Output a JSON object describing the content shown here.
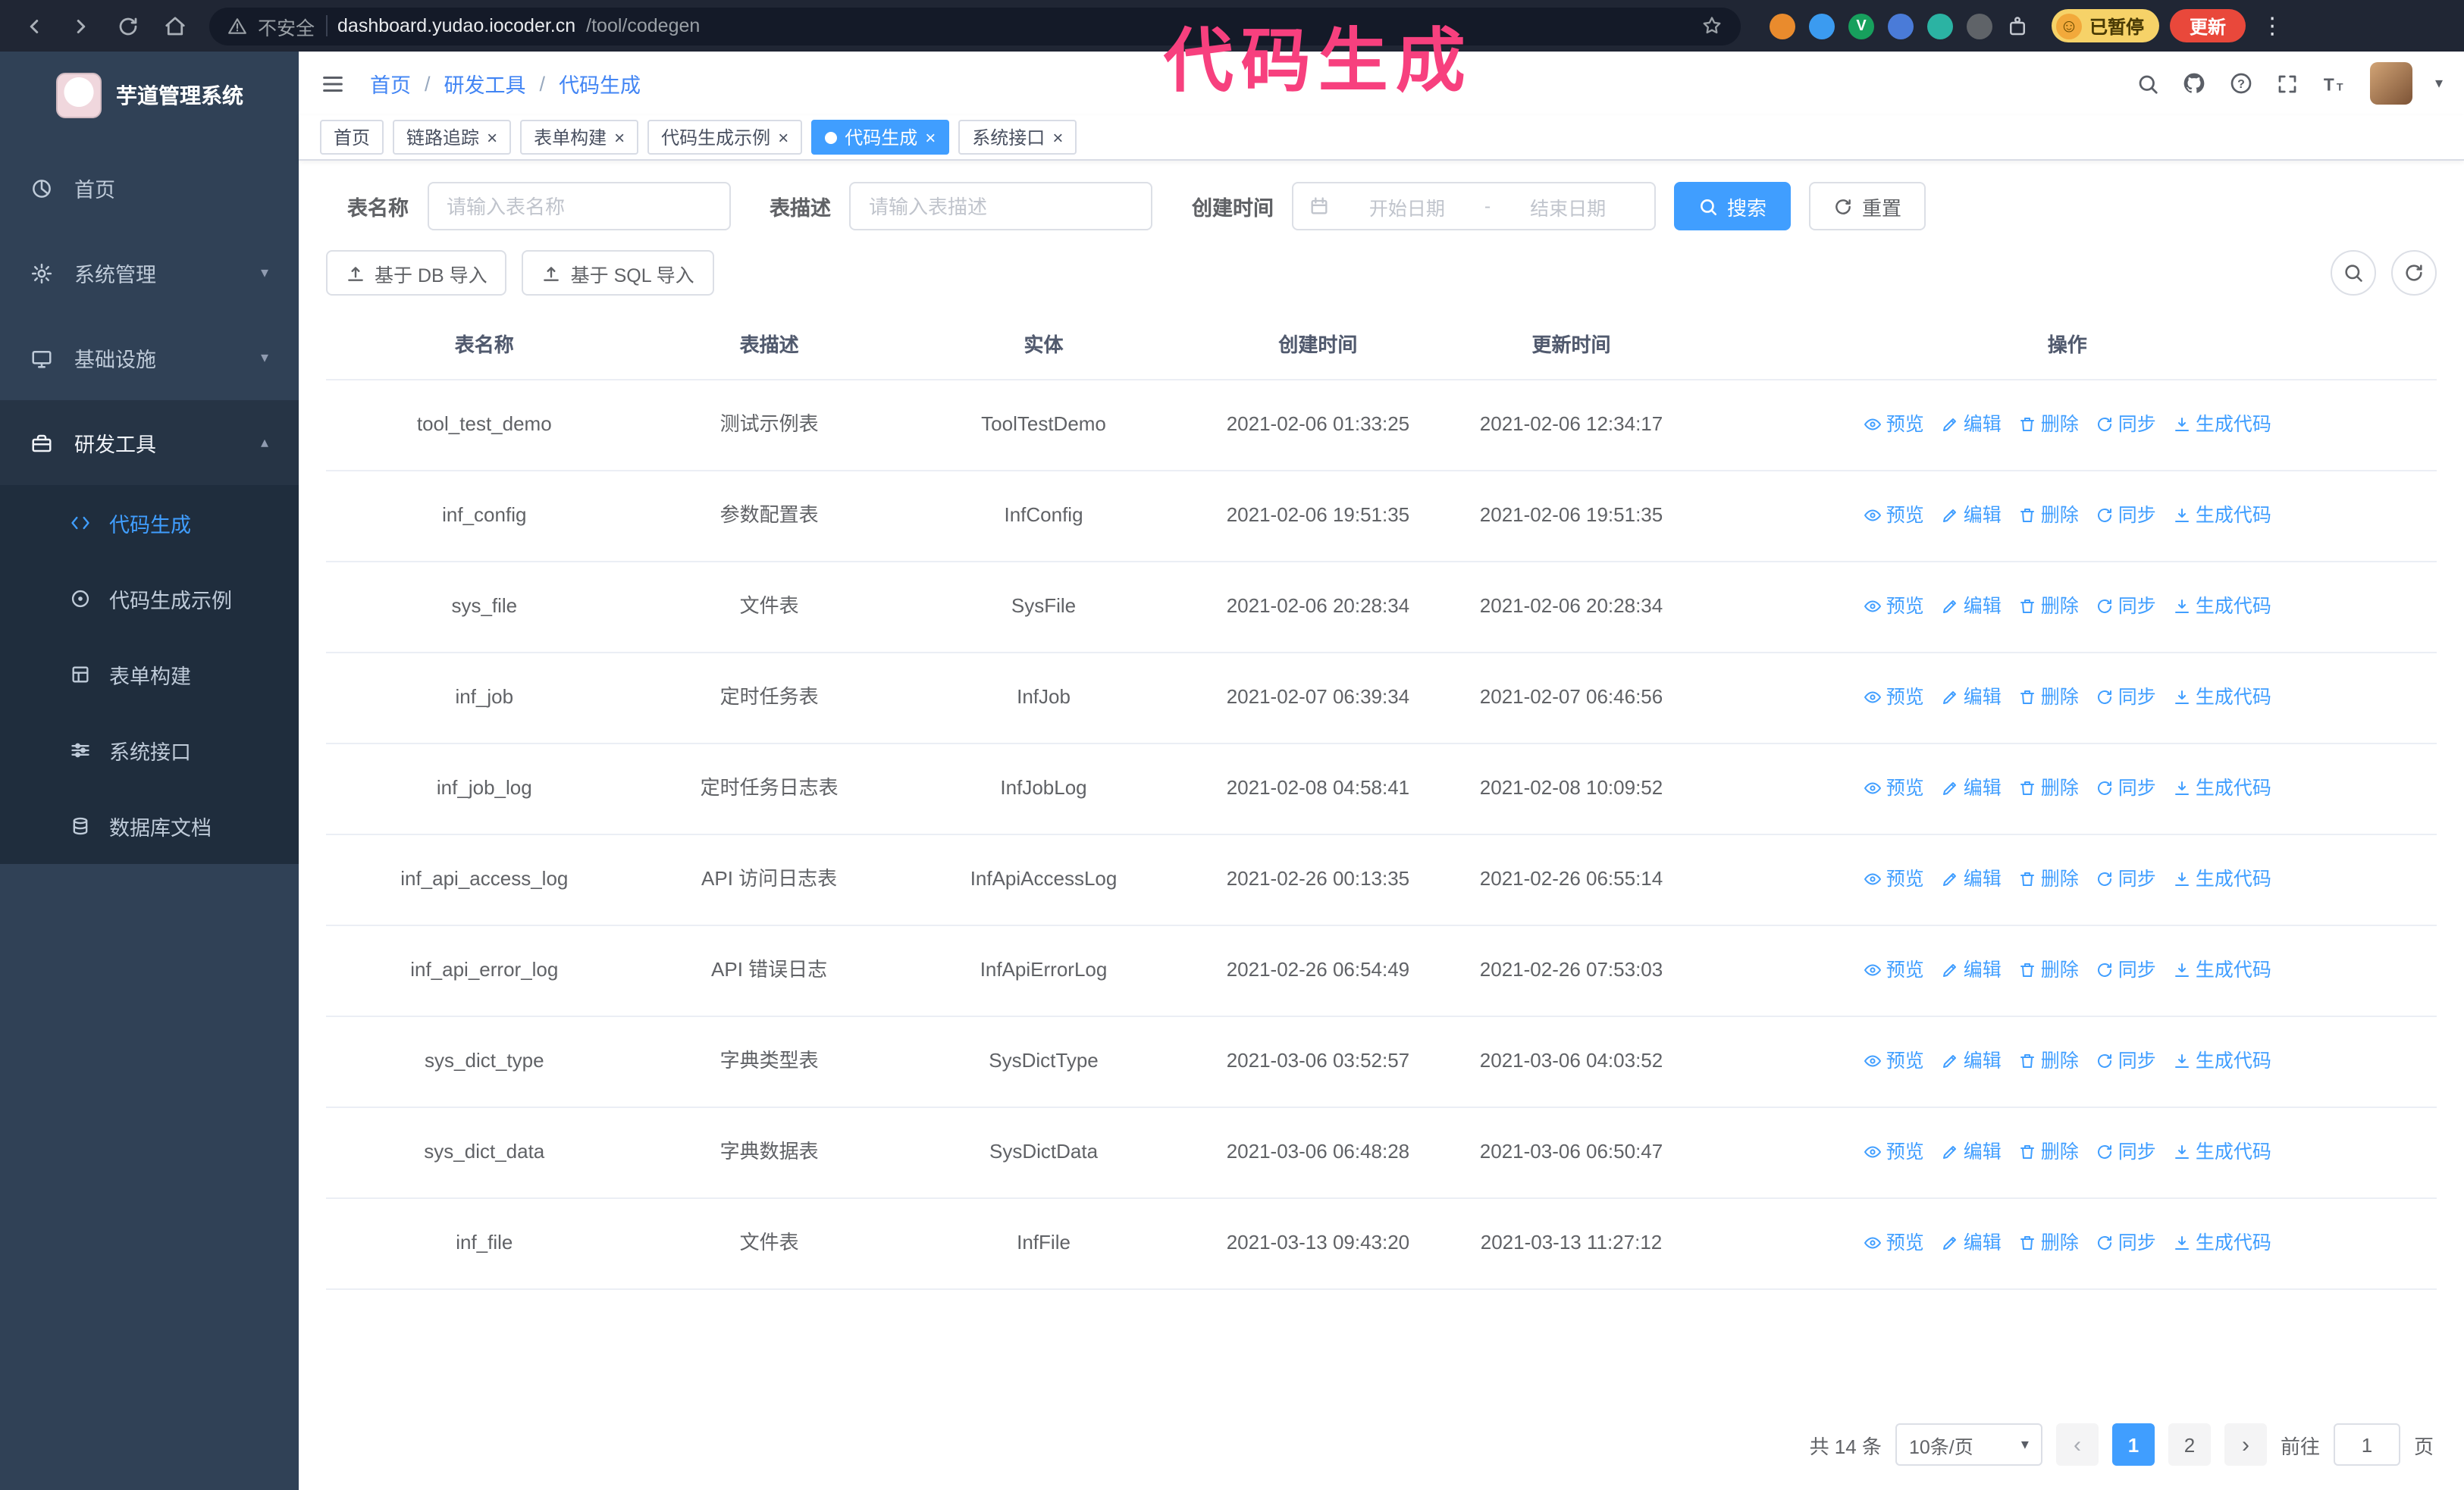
{
  "annotation": {
    "title": "代码生成"
  },
  "browser": {
    "security_label": "不安全",
    "url_host": "dashboard.yudao.iocoder.cn",
    "url_path": "/tool/codegen",
    "paused_badge": "已暂停",
    "update_button": "更新"
  },
  "sidebar": {
    "app_title": "芋道管理系统",
    "items": [
      {
        "label": "首页"
      },
      {
        "label": "系统管理"
      },
      {
        "label": "基础设施"
      },
      {
        "label": "研发工具"
      }
    ],
    "sub_items": [
      {
        "label": "代码生成"
      },
      {
        "label": "代码生成示例"
      },
      {
        "label": "表单构建"
      },
      {
        "label": "系统接口"
      },
      {
        "label": "数据库文档"
      }
    ]
  },
  "header": {
    "breadcrumb": [
      "首页",
      "研发工具",
      "代码生成"
    ],
    "breadcrumb_separator": "/"
  },
  "tabs": [
    {
      "label": "首页",
      "closable": false,
      "active": false
    },
    {
      "label": "链路追踪",
      "closable": true,
      "active": false
    },
    {
      "label": "表单构建",
      "closable": true,
      "active": false
    },
    {
      "label": "代码生成示例",
      "closable": true,
      "active": false
    },
    {
      "label": "代码生成",
      "closable": true,
      "active": true
    },
    {
      "label": "系统接口",
      "closable": true,
      "active": false
    }
  ],
  "filters": {
    "table_name_label": "表名称",
    "table_name_placeholder": "请输入表名称",
    "table_desc_label": "表描述",
    "table_desc_placeholder": "请输入表描述",
    "create_time_label": "创建时间",
    "date_start_placeholder": "开始日期",
    "date_range_separator": "-",
    "date_end_placeholder": "结束日期",
    "search_button": "搜索",
    "reset_button": "重置"
  },
  "toolbar": {
    "import_db_button": "基于 DB 导入",
    "import_sql_button": "基于 SQL 导入"
  },
  "table": {
    "columns": [
      "表名称",
      "表描述",
      "实体",
      "创建时间",
      "更新时间",
      "操作"
    ],
    "actions": [
      "预览",
      "编辑",
      "删除",
      "同步",
      "生成代码"
    ],
    "rows": [
      {
        "name": "tool_test_demo",
        "desc": "测试示例表",
        "entity": "ToolTestDemo",
        "created": "2021-02-06 01:33:25",
        "updated": "2021-02-06 12:34:17"
      },
      {
        "name": "inf_config",
        "desc": "参数配置表",
        "entity": "InfConfig",
        "created": "2021-02-06 19:51:35",
        "updated": "2021-02-06 19:51:35"
      },
      {
        "name": "sys_file",
        "desc": "文件表",
        "entity": "SysFile",
        "created": "2021-02-06 20:28:34",
        "updated": "2021-02-06 20:28:34"
      },
      {
        "name": "inf_job",
        "desc": "定时任务表",
        "entity": "InfJob",
        "created": "2021-02-07 06:39:34",
        "updated": "2021-02-07 06:46:56"
      },
      {
        "name": "inf_job_log",
        "desc": "定时任务日志表",
        "entity": "InfJobLog",
        "created": "2021-02-08 04:58:41",
        "updated": "2021-02-08 10:09:52"
      },
      {
        "name": "inf_api_access_log",
        "desc": "API 访问日志表",
        "entity": "InfApiAccessLog",
        "created": "2021-02-26 00:13:35",
        "updated": "2021-02-26 06:55:14"
      },
      {
        "name": "inf_api_error_log",
        "desc": "API 错误日志",
        "entity": "InfApiErrorLog",
        "created": "2021-02-26 06:54:49",
        "updated": "2021-02-26 07:53:03"
      },
      {
        "name": "sys_dict_type",
        "desc": "字典类型表",
        "entity": "SysDictType",
        "created": "2021-03-06 03:52:57",
        "updated": "2021-03-06 04:03:52"
      },
      {
        "name": "sys_dict_data",
        "desc": "字典数据表",
        "entity": "SysDictData",
        "created": "2021-03-06 06:48:28",
        "updated": "2021-03-06 06:50:47"
      },
      {
        "name": "inf_file",
        "desc": "文件表",
        "entity": "InfFile",
        "created": "2021-03-13 09:43:20",
        "updated": "2021-03-13 11:27:12"
      }
    ]
  },
  "pagination": {
    "total_text": "共 14 条",
    "page_size": "10条/页",
    "pages": [
      "1",
      "2"
    ],
    "active_page": "1",
    "goto_label": "前往",
    "goto_value": "1",
    "goto_unit": "页"
  }
}
